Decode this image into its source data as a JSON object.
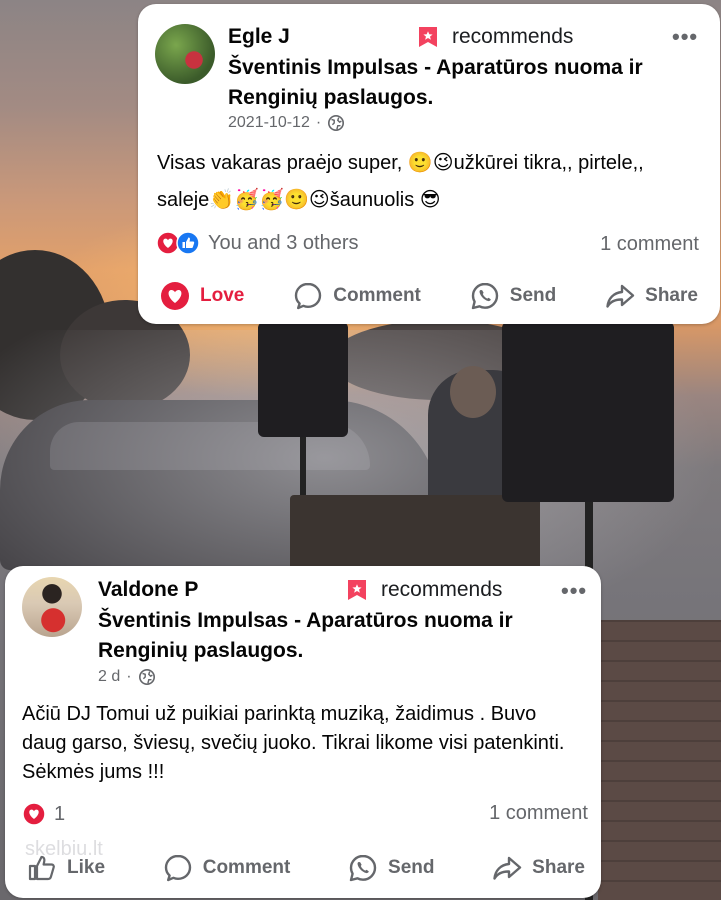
{
  "posts": [
    {
      "author": "Egle J",
      "action_label": "recommends",
      "page_name": "Šventinis Impulsas - Aparatūros nuoma ir Renginių paslaugos.",
      "date": "2021-10-12",
      "separator": "·",
      "text": "Visas vakaras praėjo super, 🙂😉užkūrei tikra,, pirtele,, saleje👏🥳🥳🙂😉šaunuolis 😎",
      "reactions_text": "You and 3 others",
      "comments_text": "1 comment",
      "buttons": {
        "react": "Love",
        "comment": "Comment",
        "send": "Send",
        "share": "Share"
      }
    },
    {
      "author": "Valdone P",
      "action_label": "recommends",
      "page_name": "Šventinis Impulsas - Aparatūros nuoma ir Renginių paslaugos.",
      "date": "2 d",
      "separator": "·",
      "text": "Ačiū DJ Tomui už puikiai parinktą muziką, žaidimus . Buvo daug garso, šviesų, svečių juoko. Tikrai likome visi patenkinti. Sėkmės jums !!!",
      "reactions_text": "1",
      "comments_text": "1 comment",
      "buttons": {
        "react": "Like",
        "comment": "Comment",
        "send": "Send",
        "share": "Share"
      }
    }
  ],
  "more_label": "•••",
  "watermark": "skelbiu.lt",
  "colors": {
    "love": "#e41e3f",
    "like": "#1877f2",
    "muted": "#65676b",
    "recommend": "#f3425f"
  }
}
